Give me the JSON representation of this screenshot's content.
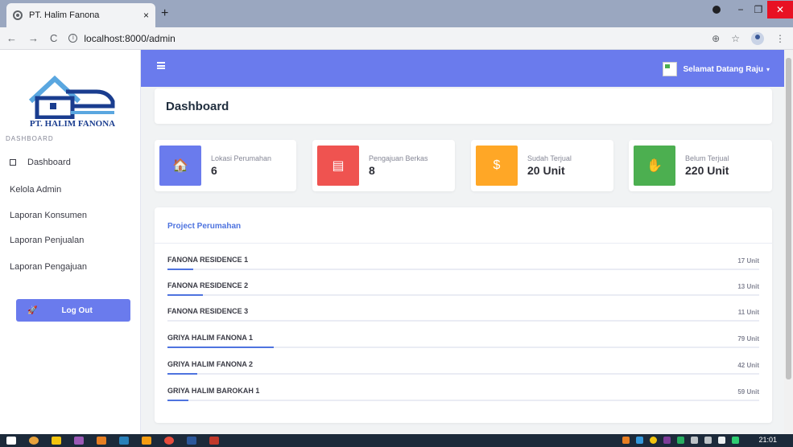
{
  "browser": {
    "tab_title": "PT. Halim Fanona",
    "tab_close": "×",
    "new_tab": "+",
    "url": "localhost:8000/admin",
    "url_info": "i",
    "back": "←",
    "forward": "→",
    "reload": "C",
    "zoom": "⊕",
    "star": "☆",
    "menu": "⋮",
    "minimize": "−",
    "maximize": "❐",
    "close": "✕"
  },
  "sidebar": {
    "logo_text": "PT. HALIM FANONA",
    "heading": "DASHBOARD",
    "items": [
      {
        "label": "Dashboard"
      },
      {
        "label": "Kelola Admin"
      },
      {
        "label": "Laporan Konsumen"
      },
      {
        "label": "Laporan Penjualan"
      },
      {
        "label": "Laporan Pengajuan"
      }
    ],
    "logout_label": "Log Out",
    "logout_icon": "🚀"
  },
  "topbar": {
    "user_greeting": "Selamat Datang Raju",
    "caret": "▾"
  },
  "page": {
    "title": "Dashboard"
  },
  "stats": [
    {
      "label": "Lokasi Perumahan",
      "value": "6",
      "icon": "home-icon",
      "glyph": "🏠",
      "color": "#6a7bed"
    },
    {
      "label": "Pengajuan Berkas",
      "value": "8",
      "icon": "document-icon",
      "glyph": "▤",
      "color": "#ef5350"
    },
    {
      "label": "Sudah Terjual",
      "value": "20 Unit",
      "icon": "hand-money-icon",
      "glyph": "$",
      "color": "#ffa726"
    },
    {
      "label": "Belum Terjual",
      "value": "220 Unit",
      "icon": "hand-icon",
      "glyph": "✋",
      "color": "#4caf50"
    }
  ],
  "projects": {
    "title": "Project Perumahan",
    "rows": [
      {
        "name": "FANONA RESIDENCE 1",
        "count": "17 Unit",
        "fill": 0.043
      },
      {
        "name": "FANONA RESIDENCE 2",
        "count": "13 Unit",
        "fill": 0.06
      },
      {
        "name": "FANONA RESIDENCE 3",
        "count": "11 Unit",
        "fill": 0.0
      },
      {
        "name": "GRIYA HALIM FANONA 1",
        "count": "79 Unit",
        "fill": 0.18
      },
      {
        "name": "GRIYA HALIM FANONA 2",
        "count": "42 Unit",
        "fill": 0.05
      },
      {
        "name": "GRIYA HALIM BAROKAH 1",
        "count": "59 Unit",
        "fill": 0.035
      }
    ]
  },
  "taskbar": {
    "clock": "21:01"
  }
}
